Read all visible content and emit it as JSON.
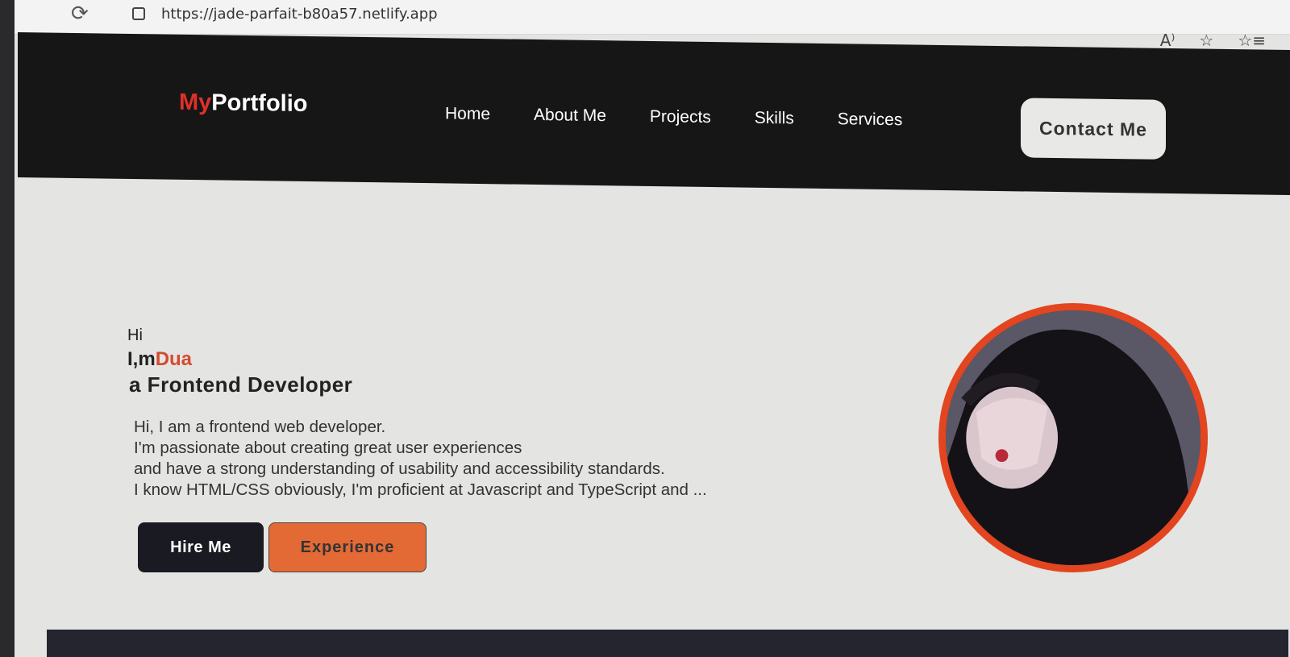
{
  "browser": {
    "url": "https://jade-parfait-b80a57.netlify.app",
    "tool_icons": [
      "read-aloud-icon",
      "favorite-star-icon",
      "favorites-list-icon"
    ]
  },
  "nav": {
    "logo_accent": "My",
    "logo_rest": "Portfolio",
    "links": [
      "Home",
      "About Me",
      "Projects",
      "Skills",
      "Services"
    ],
    "contact": "Contact Me"
  },
  "hero": {
    "greeting": "Hi",
    "intro_prefix": "I,m",
    "name": "Dua",
    "role": "a Frontend Developer",
    "description": [
      "Hi, I am a frontend web developer.",
      "I'm passionate about creating great user experiences",
      "and have a strong understanding of usability and accessibility standards.",
      "I know HTML/CSS obviously, I'm proficient at Javascript and TypeScript and ..."
    ],
    "hire_button": "Hire Me",
    "experience_button": "Experience"
  },
  "colors": {
    "accent": "#e0302a",
    "name": "#d44a30",
    "experience_button": "#e36a35",
    "profile_border": "#e2451f",
    "navbar": "#161616"
  }
}
